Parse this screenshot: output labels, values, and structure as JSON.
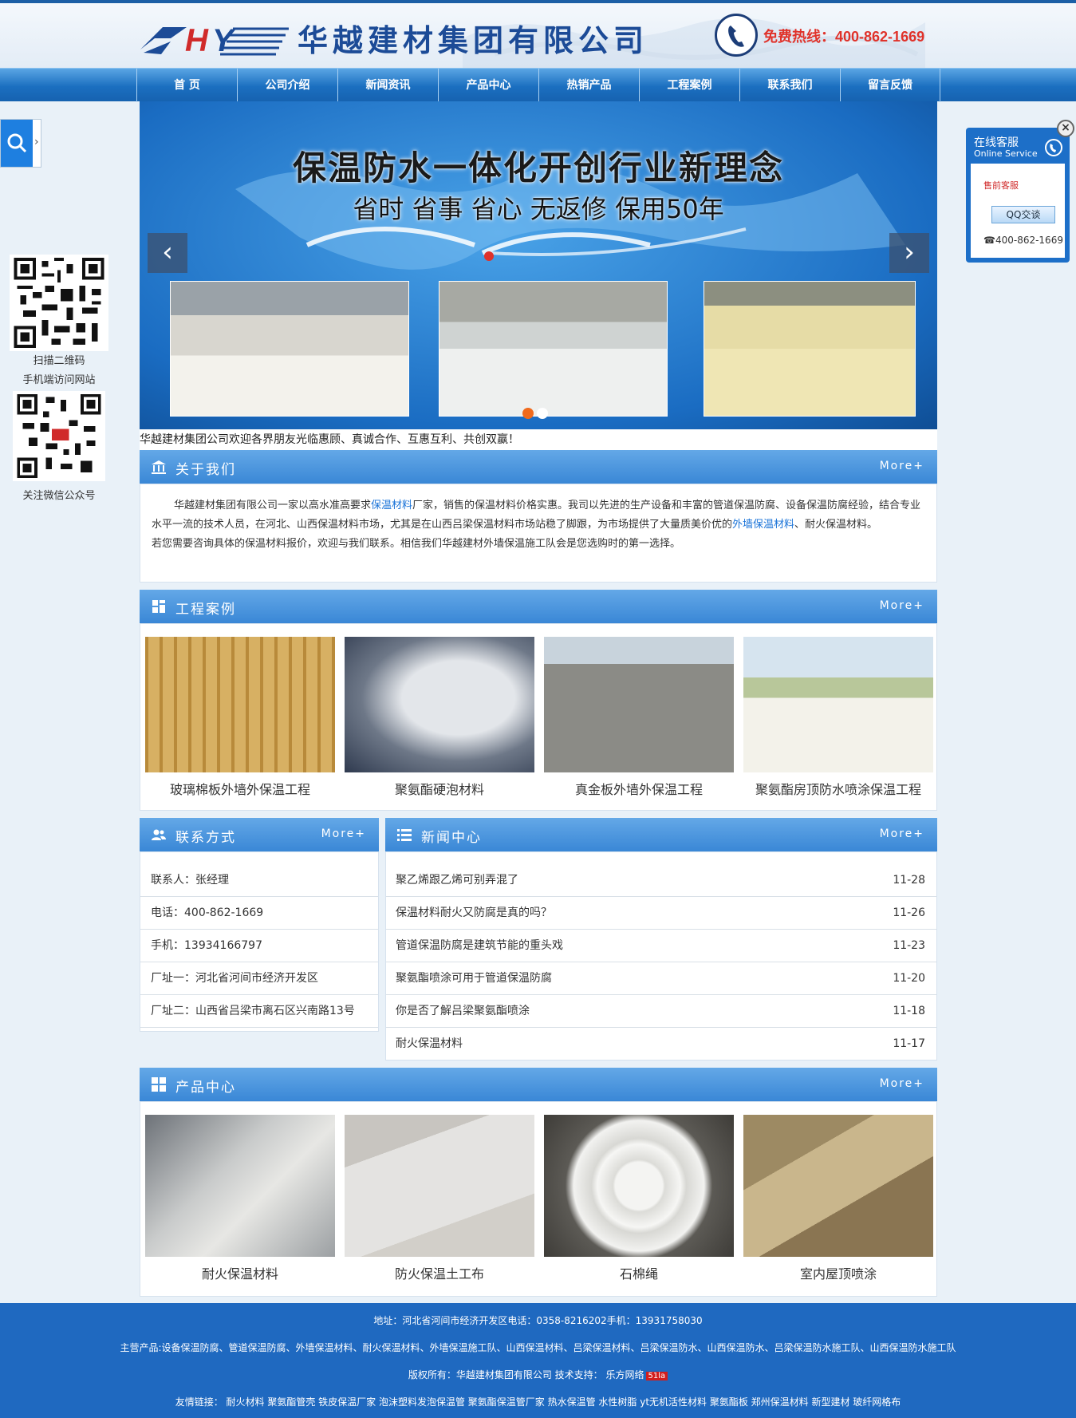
{
  "header": {
    "brand_name": "华越建材集团有限公司",
    "hotline": "免费热线：400-862-1669"
  },
  "nav": {
    "items": [
      "首 页",
      "公司介绍",
      "新闻资讯",
      "产品中心",
      "热销产品",
      "工程案例",
      "联系我们",
      "留言反馈"
    ]
  },
  "left_float": {
    "qr1_label_1": "扫描二维码",
    "qr1_label_2": "手机端访问网站",
    "qr2_label": "关注微信公众号"
  },
  "online_service": {
    "title_cn": "在线客服",
    "title_en": "Online Service",
    "group": "售前客服",
    "qq_button": "QQ交谈",
    "phone": "400-862-1669"
  },
  "banner": {
    "headline": "保温防水一体化开创行业新理念",
    "subline": "省时 省事 省心 无返修 保用50年",
    "prev_icon": "chevron-left",
    "next_icon": "chevron-right",
    "active_dot_color": "#f06a1c"
  },
  "welcome": "华越建材集团公司欢迎各界朋友光临惠顾、真诚合作、互惠互利、共创双赢！",
  "about": {
    "title": "关于我们",
    "more": "More+",
    "p1_a": "华越建材集团有限公司一家以高水准高要求",
    "p1_link": "保温材料",
    "p1_b": "厂家，销售的保温材料价格实惠。我司以先进的生产设备和丰富的管道保温防腐、设备保温防腐经验，结合专业水平一流的技术人员，在河北、山西保温材料市场，尤其是在山西吕梁保温材料市场站稳了脚跟，为市场提供了大量质美价优的",
    "p1_link2": "外墙保温材料",
    "p1_c": "、耐火保温材料。",
    "p2": "若您需要咨询具体的保温材料报价，欢迎与我们联系。相信我们华越建材外墙保温施工队会是您选购时的第一选择。"
  },
  "cases": {
    "title": "工程案例",
    "more": "More+",
    "items": [
      "玻璃棉板外墙外保温工程",
      "聚氨酯硬泡材料",
      "真金板外墙外保温工程",
      "聚氨酯房顶防水喷涂保温工程"
    ]
  },
  "contact": {
    "title": "联系方式",
    "more": "More+",
    "rows": [
      "联系人：张经理",
      "电话：400-862-1669",
      "手机：13934166797",
      "厂址一：河北省河间市经济开发区",
      "厂址二：山西省吕梁市离石区兴南路13号"
    ]
  },
  "news": {
    "title": "新闻中心",
    "more": "More+",
    "rows": [
      {
        "title": "聚乙烯跟乙烯可别弄混了",
        "date": "11-28"
      },
      {
        "title": "保温材料耐火又防腐是真的吗？",
        "date": "11-26"
      },
      {
        "title": "管道保温防腐是建筑节能的重头戏",
        "date": "11-23"
      },
      {
        "title": "聚氨酯喷涂可用于管道保温防腐",
        "date": "11-20"
      },
      {
        "title": "你是否了解吕梁聚氨酯喷涂",
        "date": "11-18"
      },
      {
        "title": "耐火保温材料",
        "date": "11-17"
      }
    ]
  },
  "products": {
    "title": "产品中心",
    "more": "More+",
    "items": [
      "耐火保温材料",
      "防火保温土工布",
      "石棉绳",
      "室内屋顶喷涂"
    ]
  },
  "footer": {
    "line1": "地址：河北省河间市经济开发区电话：0358-8216202手机：13931758030",
    "line2": "主营产品:设备保温防腐、管道保温防腐、外墙保温材料、耐火保温材料、外墙保温施工队、山西保温材料、吕梁保温材料、吕梁保温防水、山西保温防水、吕梁保温防水施工队、山西保温防水施工队",
    "line3": "版权所有：华越建材集团有限公司 技术支持： 乐方网络",
    "badge": "51la",
    "line4": "友情链接： 耐火材料 聚氨酯管壳 铁皮保温厂家 泡沫塑料发泡保温管 聚氨酯保温管厂家 热水保温管 水性树脂 yt无机活性材料 聚氨酯板 郑州保温材料 新型建材 玻纤网格布"
  },
  "colors": {
    "nav_blue": "#1b6fc0",
    "section_blue": "#4a95dd",
    "footer_blue": "#1f69c0",
    "brand_red": "#d02a2a",
    "link_blue": "#1a73d8"
  }
}
